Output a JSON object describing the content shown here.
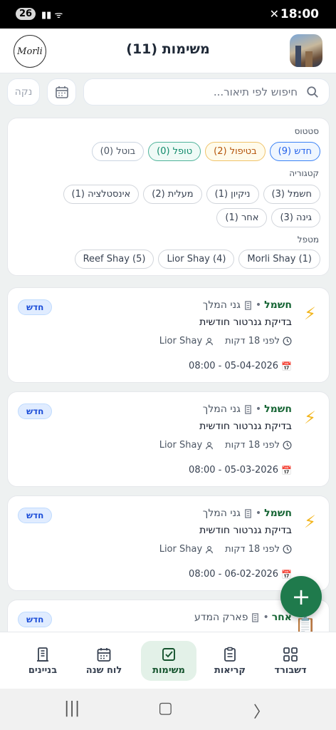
{
  "status_bar": {
    "time": "18:00",
    "notification_count": "26"
  },
  "header": {
    "title": "משימות (11)",
    "logo_text": "Morli"
  },
  "search": {
    "placeholder": "חיפוש לפי תיאור...",
    "clear_label": "נקה"
  },
  "filters": {
    "status_label": "סטטוס",
    "status_chips": [
      "חדש (9)",
      "בטיפול (2)",
      "טופל (0)",
      "בוטל (0)"
    ],
    "category_label": "קטגוריה",
    "category_chips": [
      "חשמל (3)",
      "ניקיון (1)",
      "מעלית (2)",
      "אינסטלציה (1)",
      "גינה (3)",
      "אחר (1)"
    ],
    "handler_label": "מטפל",
    "handler_chips": [
      "Morli Shay (1)",
      "Lior Shay (4)",
      "Reef Shay (5)"
    ]
  },
  "tasks": [
    {
      "category": "חשמל",
      "building": "גני המלך",
      "description": "בדיקת גנרטור חודשית",
      "elapsed": "לפני 18 דקות",
      "assignee": "Lior Shay",
      "scheduled": "05-04-2026 - 08:00",
      "status": "חדש"
    },
    {
      "category": "חשמל",
      "building": "גני המלך",
      "description": "בדיקת גנרטור חודשית",
      "elapsed": "לפני 18 דקות",
      "assignee": "Lior Shay",
      "scheduled": "05-03-2026 - 08:00",
      "status": "חדש"
    },
    {
      "category": "חשמל",
      "building": "גני המלך",
      "description": "בדיקת גנרטור חודשית",
      "elapsed": "לפני 18 דקות",
      "assignee": "Lior Shay",
      "scheduled": "06-02-2026 - 08:00",
      "status": "חדש"
    },
    {
      "category": "אחר",
      "building": "פארק המדע",
      "description": "",
      "status": "חדש"
    }
  ],
  "bottom_nav": {
    "items": [
      "דשבורד",
      "קריאות",
      "משימות",
      "לוח שנה",
      "בניינים"
    ],
    "active": "משימות"
  },
  "colors": {
    "primary_green": "#1f7a4c",
    "status_new_blue": "#1d4ed8",
    "bolt_yellow": "#f2b51c"
  }
}
